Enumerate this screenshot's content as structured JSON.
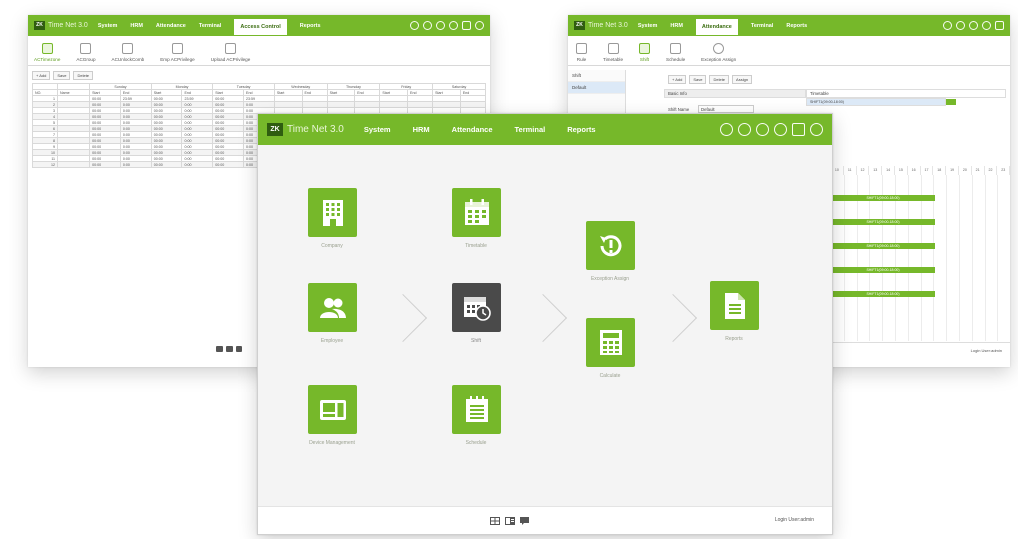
{
  "app": {
    "logo_badge": "ZK",
    "logo_text": "Time Net 3.0",
    "brand_color": "#76b82a",
    "dark_tile_color": "#4a4a4a"
  },
  "left_window": {
    "menu": [
      "System",
      "HRM",
      "Attendance",
      "Terminal",
      "Access Control",
      "Reports"
    ],
    "active_menu": "Access Control",
    "toolbar_icons": [
      {
        "label": "ACTimezone",
        "icon": "timezone-icon",
        "selected": true
      },
      {
        "label": "ACGroup",
        "icon": "group-icon",
        "selected": false
      },
      {
        "label": "ACUnlockComb",
        "icon": "unlock-icon",
        "selected": false
      },
      {
        "label": "Emp ACPrivilege",
        "icon": "privilege-icon",
        "selected": false
      },
      {
        "label": "Upload ACPrivilege",
        "icon": "upload-icon",
        "selected": false
      }
    ],
    "actions": [
      "+ Add",
      "Save",
      "Delete"
    ],
    "days": [
      "Sunday",
      "Monday",
      "Tuesday",
      "Wednesday",
      "Thursday",
      "Friday",
      "Saturday"
    ],
    "col_no": "NO.",
    "col_name": "Name",
    "col_start": "Start",
    "col_end": "End",
    "rows": [
      {
        "no": "1",
        "a": "00:00",
        "b": "23:59",
        "c": "00:00",
        "d": "23:59",
        "e": "00:00",
        "f": "23:59"
      },
      {
        "no": "2",
        "a": "00:00",
        "b": "0:00",
        "c": "00:00",
        "d": "0:00",
        "e": "00:00",
        "f": "0:00"
      },
      {
        "no": "3",
        "a": "00:00",
        "b": "0:00",
        "c": "00:00",
        "d": "0:00",
        "e": "00:00",
        "f": "0:00"
      },
      {
        "no": "4",
        "a": "00:00",
        "b": "0:00",
        "c": "00:00",
        "d": "0:00",
        "e": "00:00",
        "f": "0:00"
      },
      {
        "no": "5",
        "a": "00:00",
        "b": "0:00",
        "c": "00:00",
        "d": "0:00",
        "e": "00:00",
        "f": "0:00"
      },
      {
        "no": "6",
        "a": "00:00",
        "b": "0:00",
        "c": "00:00",
        "d": "0:00",
        "e": "00:00",
        "f": "0:00"
      },
      {
        "no": "7",
        "a": "00:00",
        "b": "0:00",
        "c": "00:00",
        "d": "0:00",
        "e": "00:00",
        "f": "0:00"
      },
      {
        "no": "8",
        "a": "00:00",
        "b": "0:00",
        "c": "00:00",
        "d": "0:00",
        "e": "00:00",
        "f": "0:00"
      },
      {
        "no": "9",
        "a": "00:00",
        "b": "0:00",
        "c": "00:00",
        "d": "0:00",
        "e": "00:00",
        "f": "0:00"
      },
      {
        "no": "10",
        "a": "00:00",
        "b": "0:00",
        "c": "00:00",
        "d": "0:00",
        "e": "00:00",
        "f": "0:00"
      },
      {
        "no": "11",
        "a": "00:00",
        "b": "0:00",
        "c": "00:00",
        "d": "0:00",
        "e": "00:00",
        "f": "0:00"
      },
      {
        "no": "12",
        "a": "00:00",
        "b": "0:00",
        "c": "00:00",
        "d": "0:00",
        "e": "00:00",
        "f": "0:00"
      }
    ]
  },
  "right_window": {
    "menu": [
      "System",
      "HRM",
      "Attendance",
      "Terminal",
      "Reports"
    ],
    "active_menu": "Attendance",
    "toolbar_icons": [
      {
        "label": "Rule",
        "icon": "rule-icon",
        "selected": false
      },
      {
        "label": "Timetable",
        "icon": "timetable-icon",
        "selected": false
      },
      {
        "label": "Shift",
        "icon": "shift-icon",
        "selected": true
      },
      {
        "label": "Schedule",
        "icon": "schedule-icon",
        "selected": false
      },
      {
        "label": "Exception Assign",
        "icon": "exception-icon",
        "selected": false
      }
    ],
    "actions": [
      "+ Add",
      "Save",
      "Delete",
      "Assign"
    ],
    "side_items": [
      "Shift",
      "Default"
    ],
    "basic_info": "Basic Info",
    "timetable_header": "Timetable",
    "timetable_entry": "SHIFT1(09:00-18:00)",
    "shift_name_label": "Shift Name",
    "shift_name_value": "Default",
    "hours": [
      "10",
      "11",
      "12",
      "13",
      "14",
      "15",
      "16",
      "17",
      "18",
      "19",
      "20",
      "21",
      "22",
      "23"
    ],
    "gantt_bars": [
      "SHIFT1(09:00-18:00)",
      "SHIFT1(09:00-18:00)",
      "SHIFT1(09:00-18:00)",
      "SHIFT1(09:00-18:00)",
      "SHIFT1(09:00-18:00)"
    ],
    "login_text": "Login User:admin"
  },
  "main_window": {
    "menu": [
      "System",
      "HRM",
      "Attendance",
      "Terminal",
      "Reports"
    ],
    "tiles": [
      {
        "key": "company",
        "label": "Company",
        "icon": "building-icon"
      },
      {
        "key": "employee",
        "label": "Employee",
        "icon": "users-icon"
      },
      {
        "key": "device",
        "label": "Device Management",
        "icon": "terminal-icon"
      },
      {
        "key": "timetable",
        "label": "Timetable",
        "icon": "calendar-icon"
      },
      {
        "key": "shift",
        "label": "Shift",
        "icon": "calendar-clock-icon"
      },
      {
        "key": "schedule",
        "label": "Schedule",
        "icon": "notepad-icon"
      },
      {
        "key": "exception",
        "label": "Exception Assign",
        "icon": "refresh-exclaim-icon"
      },
      {
        "key": "calculate",
        "label": "Calculate",
        "icon": "calculator-icon"
      },
      {
        "key": "reports",
        "label": "Reports",
        "icon": "document-icon"
      }
    ],
    "login_text": "Login User:admin"
  }
}
